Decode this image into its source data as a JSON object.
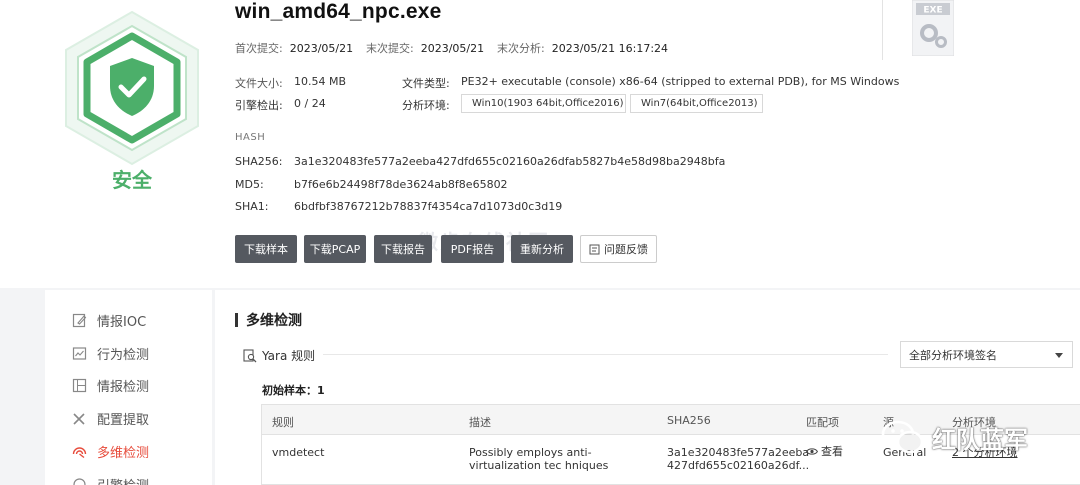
{
  "file": {
    "name": "win_amd64_npc.exe",
    "verdict": "安全"
  },
  "dates": {
    "first_submit_label": "首次提交:",
    "first_submit": "2023/05/21",
    "last_submit_label": "末次提交:",
    "last_submit": "2023/05/21",
    "last_analysis_label": "末次分析:",
    "last_analysis": "2023/05/21 16:17:24"
  },
  "info": {
    "size_label": "文件大小:",
    "size": "10.54 MB",
    "type_label": "文件类型:",
    "type": "PE32+ executable (console) x86-64 (stripped to external PDB), for MS Windows",
    "engine_label": "引擎检出:",
    "engine": "0 / 24",
    "env_label": "分析环境:",
    "env1": "Win10(1903 64bit,Office2016)",
    "env2": "Win7(64bit,Office2013)"
  },
  "hash": {
    "title": "HASH",
    "sha256_label": "SHA256:",
    "sha256": "3a1e320483fe577a2eeba427dfd655c02160a26dfab5827b4e58d98ba2948bfa",
    "md5_label": "MD5:",
    "md5": "b7f6e6b24498f78de3624ab8f8e65802",
    "sha1_label": "SHA1:",
    "sha1": "6bdfbf38767212b78837f4354ca7d1073d0c3d19"
  },
  "buttons": {
    "download_sample": "下载样本",
    "download_pcap": "下载PCAP",
    "download_report": "下载报告",
    "pdf_report": "PDF报告",
    "reanalyze": "重新分析",
    "feedback": "问题反馈"
  },
  "exe_icon_label": "EXE",
  "background_watermark": "微步在线社区",
  "sidebar": {
    "items": [
      {
        "label": "情报IOC"
      },
      {
        "label": "行为检测"
      },
      {
        "label": "情报检测"
      },
      {
        "label": "配置提取"
      },
      {
        "label": "多维检测"
      },
      {
        "label": "引擎检测"
      }
    ]
  },
  "main": {
    "section_title": "多维检测",
    "yara_label": "Yara 规则",
    "select_value": "全部分析环境签名",
    "initial_sample_label": "初始样本：",
    "initial_sample_count": "1",
    "table": {
      "headers": [
        "规则",
        "描述",
        "SHA256",
        "匹配项",
        "源",
        "分析环境"
      ],
      "rows": [
        {
          "rule": "vmdetect",
          "desc": "Possibly employs anti-virtualization tec hniques",
          "sha256": "3a1e320483fe577a2eeba 427dfd655c02160a26df...",
          "match": "查看",
          "source": "General",
          "env": "2 个分析环境"
        }
      ]
    }
  },
  "watermark": "红队蓝军",
  "colors": {
    "safe_green": "#4caf6a",
    "button_dark": "#555960",
    "active_red": "#e74c3c"
  }
}
